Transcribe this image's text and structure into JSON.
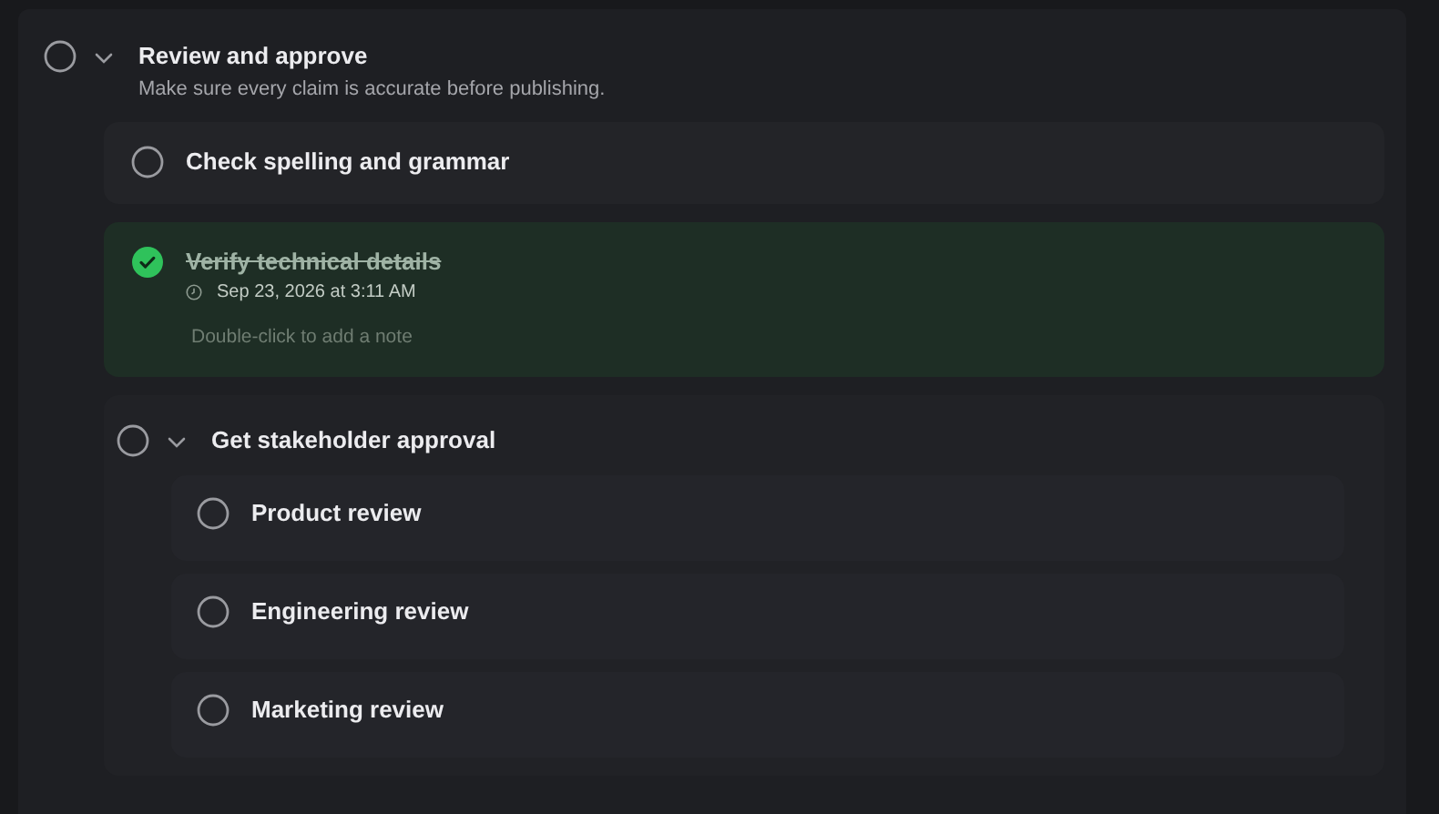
{
  "task": {
    "title": "Review and approve",
    "checked": false,
    "expanded": true,
    "note": "Make sure every claim is accurate before publishing.",
    "children": [
      {
        "title": "Check spelling and grammar",
        "checked": false
      },
      {
        "title": "Verify technical details",
        "checked": true,
        "completed_at": "Sep 23, 2026 at 3:11 AM",
        "note_placeholder": "Double-click to add a note"
      },
      {
        "title": "Get stakeholder approval",
        "checked": false,
        "expanded": true,
        "children": [
          {
            "title": "Product review",
            "checked": false
          },
          {
            "title": "Engineering review",
            "checked": false
          },
          {
            "title": "Marketing review",
            "checked": false
          }
        ]
      }
    ]
  }
}
